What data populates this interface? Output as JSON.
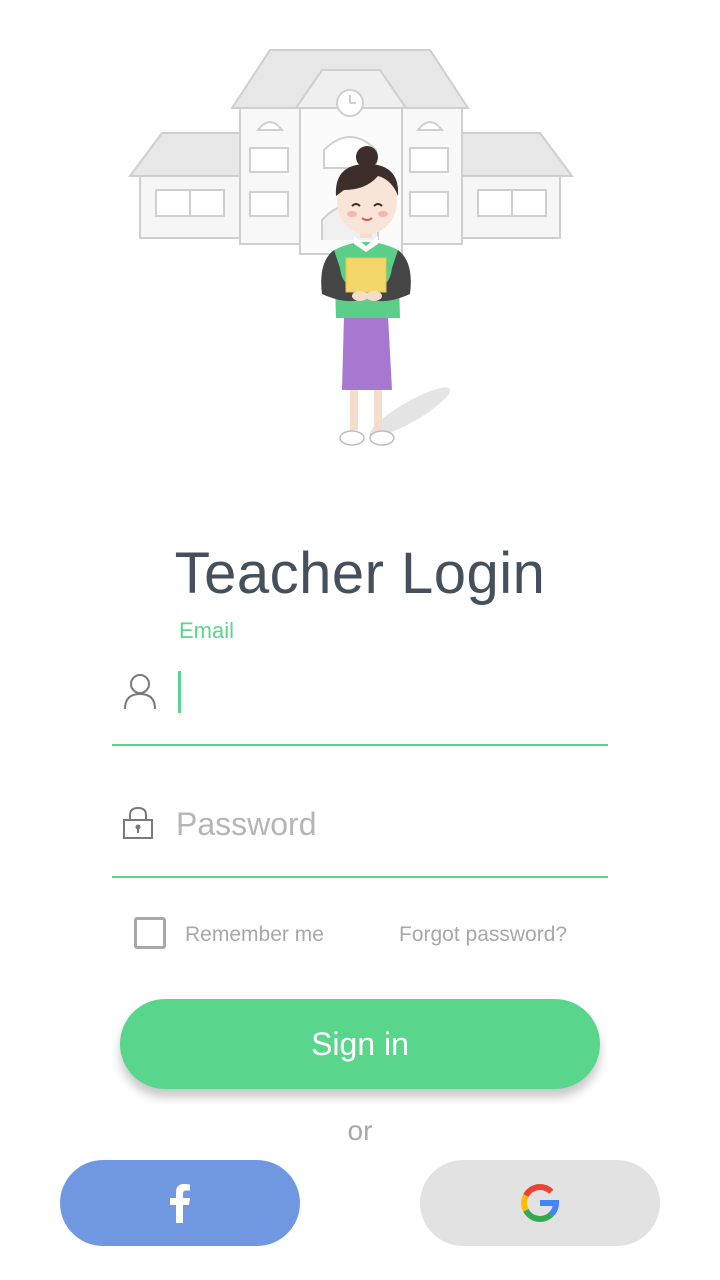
{
  "header": {
    "title": "Teacher Login"
  },
  "form": {
    "email_label": "Email",
    "email_value": "",
    "password_placeholder": "Password",
    "remember_label": "Remember me",
    "remember_checked": false,
    "forgot_label": "Forgot password?",
    "signin_label": "Sign in",
    "or_label": "or"
  },
  "social": {
    "facebook_icon": "facebook-icon",
    "google_icon": "google-icon"
  },
  "icons": {
    "email": "user-icon",
    "password": "lock-icon"
  },
  "colors": {
    "accent": "#5ad68c",
    "title": "#46505c",
    "muted": "#a8a8a8",
    "facebook": "#7098e0",
    "google_bg": "#e2e2e2"
  }
}
